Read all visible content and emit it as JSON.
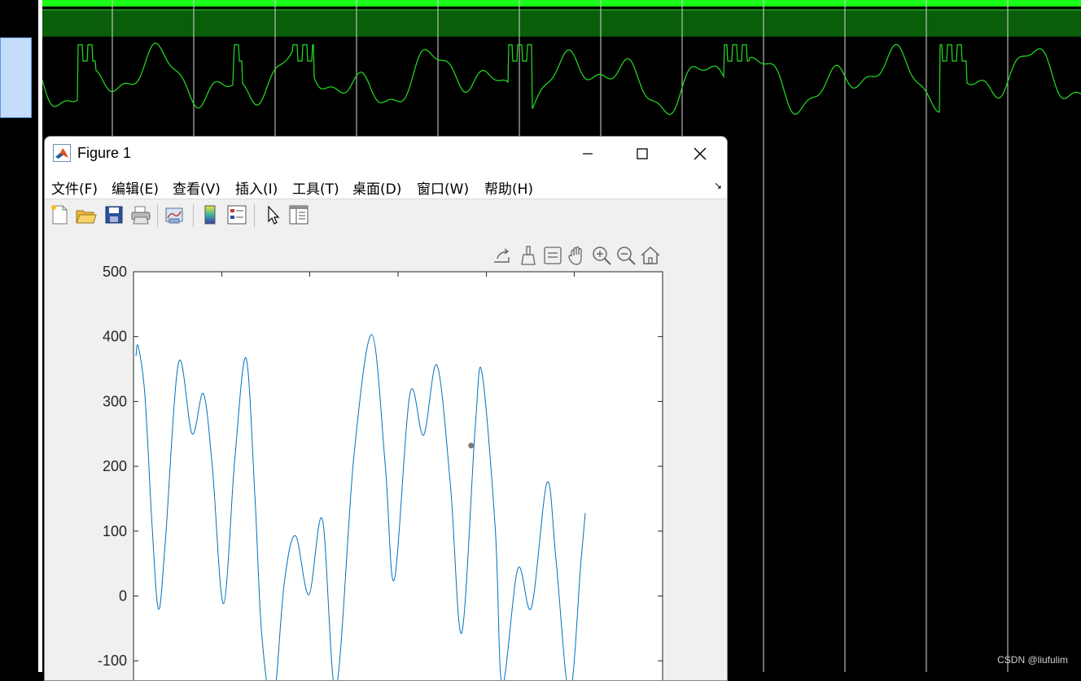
{
  "window": {
    "title": "Figure 1"
  },
  "menu": {
    "items": [
      {
        "label": "文件(F)"
      },
      {
        "label": "编辑(E)"
      },
      {
        "label": "查看(V)"
      },
      {
        "label": "插入(I)"
      },
      {
        "label": "工具(T)"
      },
      {
        "label": "桌面(D)"
      },
      {
        "label": "窗口(W)"
      },
      {
        "label": "帮助(H)"
      }
    ]
  },
  "toolbar": {
    "buttons": [
      "new-figure-icon",
      "open-file-icon",
      "save-icon",
      "print-icon",
      "link-plot-icon",
      "insert-colorbar-icon",
      "insert-legend-icon",
      "pointer-icon",
      "property-inspector-icon"
    ]
  },
  "axes_toolbar": {
    "buttons": [
      "export-icon",
      "brush-icon",
      "datatip-icon",
      "pan-icon",
      "zoom-in-icon",
      "zoom-out-icon",
      "home-icon"
    ]
  },
  "colors": {
    "line": "#0072bd",
    "waveform": "#23e023",
    "waveform_band": "#0a5e0a"
  },
  "chart_data": {
    "type": "line",
    "title": "",
    "xlabel": "",
    "ylabel": "",
    "ylim": [
      -165,
      500
    ],
    "yticks": [
      -100,
      0,
      100,
      200,
      300,
      400,
      500
    ],
    "ytick_labels": [
      "-100",
      "0",
      "100",
      "200",
      "300",
      "400",
      "500"
    ],
    "x_samples": [
      0,
      1,
      2,
      3,
      4,
      5,
      6,
      7,
      8,
      9,
      10,
      11,
      12,
      13,
      14,
      15,
      16,
      17,
      18,
      19,
      20,
      21,
      22,
      23,
      24,
      25,
      26,
      27,
      28,
      29,
      30,
      31,
      32,
      33,
      34,
      35,
      36,
      37,
      38,
      39,
      40,
      41,
      42,
      43,
      44,
      45,
      46,
      47,
      48,
      49,
      50,
      51,
      52,
      53,
      54,
      55,
      56,
      57,
      58,
      59,
      60,
      61,
      62,
      63,
      64,
      65,
      66,
      67,
      68,
      69,
      70,
      71,
      72,
      73,
      74,
      75,
      76,
      77,
      78,
      79,
      80,
      81,
      82,
      83,
      84,
      85,
      86,
      87,
      88,
      89,
      90,
      91,
      92,
      93,
      94,
      95,
      96,
      97,
      98,
      99,
      100
    ],
    "series": [
      {
        "y_keypoints": [
          [
            0,
            370
          ],
          [
            0.5,
            385
          ],
          [
            2,
            310
          ],
          [
            3.5,
            120
          ],
          [
            5,
            -20
          ],
          [
            6.5,
            80
          ],
          [
            9.5,
            360
          ],
          [
            12.5,
            250
          ],
          [
            15,
            312
          ],
          [
            17,
            200
          ],
          [
            19.5,
            -12
          ],
          [
            22,
            210
          ],
          [
            24.5,
            367
          ],
          [
            26.5,
            150
          ],
          [
            28,
            -60
          ],
          [
            30.5,
            -167
          ],
          [
            33,
            20
          ],
          [
            35.5,
            93
          ],
          [
            38.5,
            2
          ],
          [
            41.5,
            118
          ],
          [
            44.5,
            -143
          ],
          [
            48.5,
            215
          ],
          [
            52.5,
            403
          ],
          [
            55.5,
            200
          ],
          [
            57.5,
            25
          ],
          [
            61,
            312
          ],
          [
            64,
            248
          ],
          [
            67,
            356
          ],
          [
            70,
            170
          ],
          [
            72.5,
            -57
          ],
          [
            75.5,
            260
          ],
          [
            77,
            345
          ],
          [
            80,
            100
          ],
          [
            81.5,
            -137
          ],
          [
            85,
            42
          ],
          [
            88,
            -18
          ],
          [
            91.5,
            175
          ],
          [
            93.5,
            55
          ],
          [
            96.5,
            -152
          ],
          [
            99,
            50
          ],
          [
            100,
            128
          ]
        ]
      }
    ],
    "marker_point": {
      "x": 74.6,
      "y": 232
    }
  },
  "watermark": "CSDN @liufulim"
}
